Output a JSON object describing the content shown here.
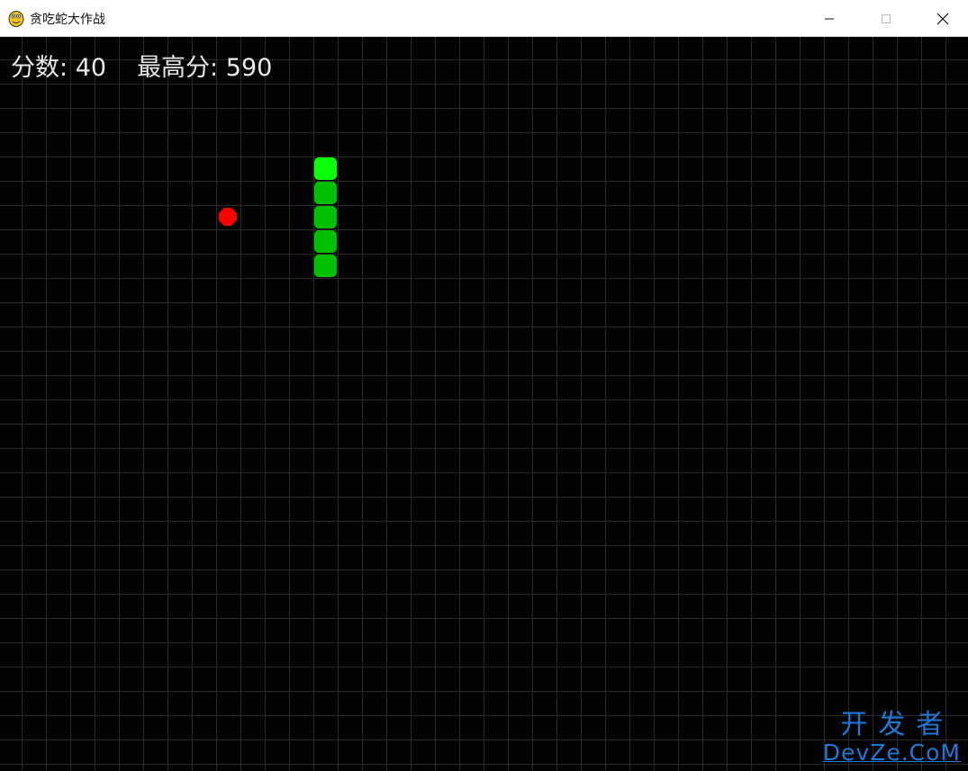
{
  "window": {
    "title": "贪吃蛇大作战",
    "icon": "python-snake-icon",
    "controls": [
      "minimize-icon",
      "maximize-icon",
      "close-icon"
    ]
  },
  "hud": {
    "score_label": "分数:",
    "score_value": "40",
    "highscore_label": "最高分:",
    "highscore_value": "590"
  },
  "board": {
    "background": "#030303",
    "grid_color": "#2a2a2a",
    "cell_size": 27,
    "grid_offset": [
      -3,
      -2
    ],
    "snake": {
      "head_color": "#0bff0b",
      "body_color": "#00c000",
      "cells": [
        [
          13,
          5
        ],
        [
          13,
          6
        ],
        [
          13,
          7
        ],
        [
          13,
          8
        ],
        [
          13,
          9
        ]
      ]
    },
    "food": {
      "color": "#ff0000",
      "cell": [
        9,
        7
      ]
    }
  },
  "watermark": {
    "cn": "开发者",
    "en": "DevZe.CoM"
  }
}
